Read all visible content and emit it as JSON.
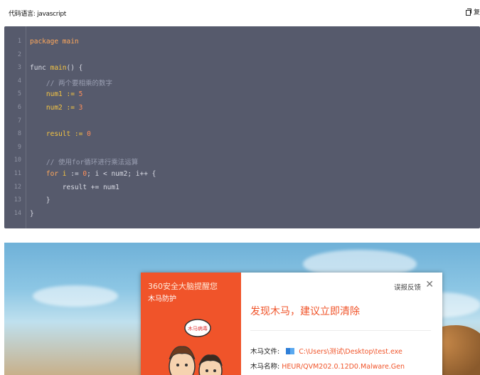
{
  "code_card": {
    "language_label": "代码语言: javascript",
    "copy_label": "复",
    "lines": [
      {
        "no": "1",
        "parts": [
          {
            "t": "package main",
            "c": "kw"
          }
        ]
      },
      {
        "no": "2",
        "parts": []
      },
      {
        "no": "3",
        "parts": [
          {
            "t": "func ",
            "c": "op"
          },
          {
            "t": "main",
            "c": "fn"
          },
          {
            "t": "() {",
            "c": "op"
          }
        ]
      },
      {
        "no": "4",
        "parts": [
          {
            "t": "    // 两个要相乘的数字",
            "c": "cm"
          }
        ]
      },
      {
        "no": "5",
        "parts": [
          {
            "t": "    num1 := ",
            "c": "fn"
          },
          {
            "t": "5",
            "c": "num"
          }
        ]
      },
      {
        "no": "6",
        "parts": [
          {
            "t": "    num2 := ",
            "c": "fn"
          },
          {
            "t": "3",
            "c": "num"
          }
        ]
      },
      {
        "no": "7",
        "parts": []
      },
      {
        "no": "8",
        "parts": [
          {
            "t": "    result := ",
            "c": "fn"
          },
          {
            "t": "0",
            "c": "num"
          }
        ]
      },
      {
        "no": "9",
        "parts": []
      },
      {
        "no": "10",
        "parts": [
          {
            "t": "    // 使用for循环进行乘法运算",
            "c": "cm"
          }
        ]
      },
      {
        "no": "11",
        "parts": [
          {
            "t": "    for ",
            "c": "kw"
          },
          {
            "t": "i",
            "c": "fn"
          },
          {
            "t": " := ",
            "c": "op"
          },
          {
            "t": "0",
            "c": "num"
          },
          {
            "t": "; i < num2; i++ {",
            "c": "op"
          }
        ]
      },
      {
        "no": "12",
        "parts": [
          {
            "t": "        result += num1",
            "c": "op"
          }
        ]
      },
      {
        "no": "13",
        "parts": [
          {
            "t": "    }",
            "c": "op"
          }
        ]
      },
      {
        "no": "14",
        "parts": [
          {
            "t": "}",
            "c": "op"
          }
        ]
      }
    ]
  },
  "popup": {
    "brand_title": "360安全大脑提醒您",
    "brand_sub": "木马防护",
    "cartoon_tag": "木马病毒",
    "feedback": "误报反馈",
    "close_glyph": "✕",
    "alert_title": "发现木马，建议立即清除",
    "file_label": "木马文件:",
    "file_value": "C:\\Users\\测试\\Desktop\\test.exe",
    "name_label": "木马名称:",
    "name_value": "HEUR/QVM202.0.12D0.Malware.Gen"
  },
  "colors": {
    "code_bg": "#565a6c",
    "alert_orange": "#f0542a"
  }
}
